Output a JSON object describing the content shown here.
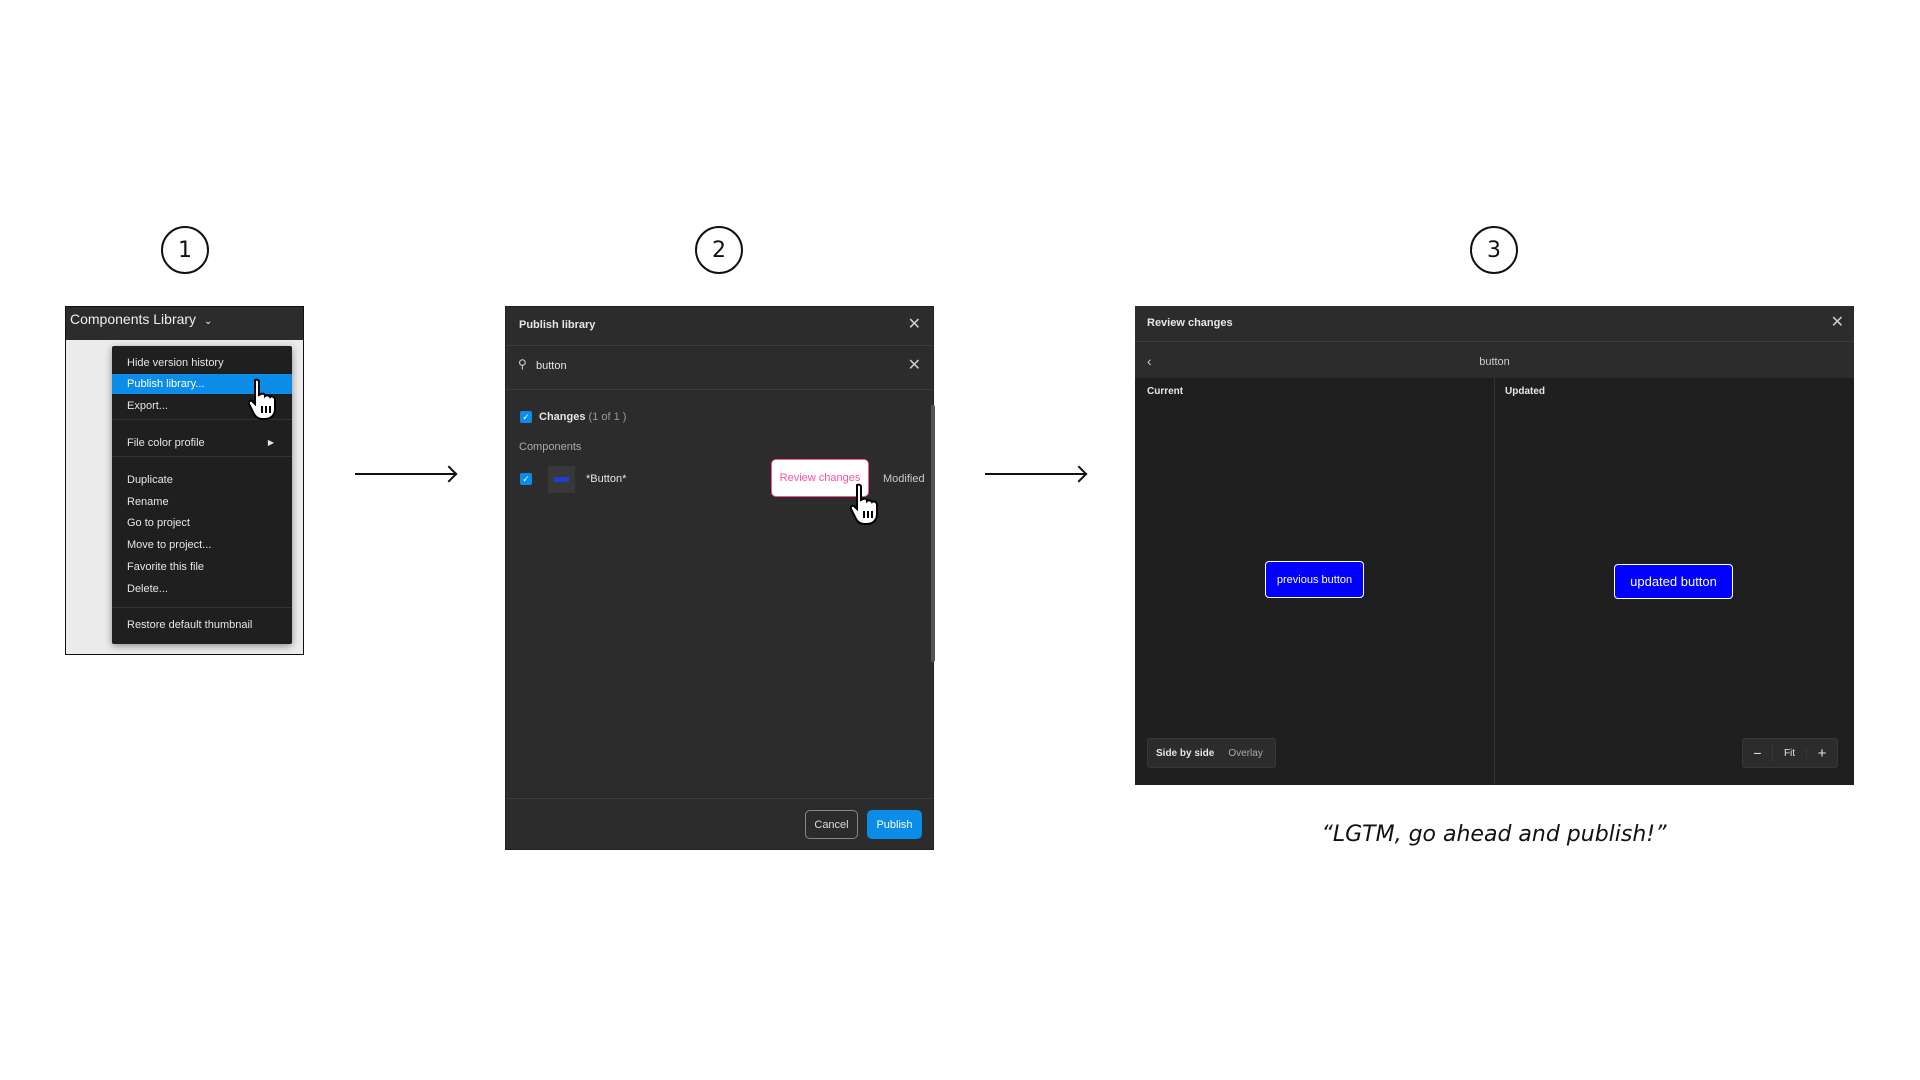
{
  "steps": [
    "1",
    "2",
    "3"
  ],
  "panel1": {
    "title": "Components Library",
    "menu": [
      "Hide version history",
      "Publish library...",
      "Export...",
      "File color profile",
      "Duplicate",
      "Rename",
      "Go to project",
      "Move to project...",
      "Favorite this file",
      "Delete...",
      "Restore default thumbnail"
    ],
    "highlighted": "Publish library..."
  },
  "panel2": {
    "title": "Publish library",
    "search_value": "button",
    "changes_label": "Changes",
    "changes_count": "(1   of 1  )",
    "section": "Components",
    "component_name": "*Button*",
    "review_label": "Review changes",
    "status": "Modified",
    "cancel": "Cancel",
    "publish": "Publish"
  },
  "panel3": {
    "title": "Review changes",
    "component": "button",
    "current_label": "Current",
    "updated_label": "Updated",
    "previous_button": "previous button",
    "updated_button": "updated button",
    "modes": [
      "Side by side",
      "Overlay"
    ],
    "zoom_fit": "Fit"
  },
  "caption": "“LGTM, go ahead and publish!”",
  "colors": {
    "accent": "#0c8ce9",
    "demo_button": "#0000ff",
    "review_highlight": "#ff4fa3"
  }
}
